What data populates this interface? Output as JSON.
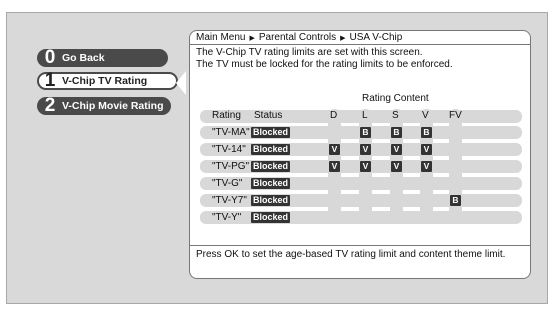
{
  "menu": {
    "items": [
      {
        "number": "0",
        "label": "Go Back"
      },
      {
        "number": "1",
        "label": "V-Chip TV Rating"
      },
      {
        "number": "2",
        "label": "V-Chip Movie Rating"
      }
    ],
    "selected_index": 1
  },
  "breadcrumb": [
    "Main Menu",
    "Parental Controls",
    "USA V-Chip"
  ],
  "description": [
    "The V-Chip TV rating limits are set with this screen.",
    "The TV must be locked for the rating limits to be enforced."
  ],
  "table": {
    "rating_content_heading": "Rating Content",
    "headers": {
      "rating": "Rating",
      "status": "Status",
      "content": [
        "D",
        "L",
        "S",
        "V",
        "FV"
      ]
    },
    "rows": [
      {
        "rating": "\"TV-MA\"",
        "status": "Blocked",
        "cells": [
          "",
          "B",
          "B",
          "B",
          ""
        ]
      },
      {
        "rating": "\"TV-14\"",
        "status": "Blocked",
        "cells": [
          "V",
          "V",
          "V",
          "V",
          ""
        ]
      },
      {
        "rating": "\"TV-PG\"",
        "status": "Blocked",
        "cells": [
          "V",
          "V",
          "V",
          "V",
          ""
        ]
      },
      {
        "rating": "\"TV-G\"",
        "status": "Blocked",
        "cells": [
          "",
          "",
          "",
          "",
          ""
        ]
      },
      {
        "rating": "\"TV-Y7\"",
        "status": "Blocked",
        "cells": [
          "",
          "",
          "",
          "",
          "B"
        ]
      },
      {
        "rating": "\"TV-Y\"",
        "status": "Blocked",
        "cells": [
          "",
          "",
          "",
          "",
          ""
        ]
      }
    ]
  },
  "footer": "Press OK to set the age-based TV rating limit and content theme limit.",
  "colors": {
    "screen_bg": "#d9d9d9",
    "button_dark": "#4a4a4a",
    "badge": "#333333",
    "row_bg": "#d8d8d8"
  }
}
